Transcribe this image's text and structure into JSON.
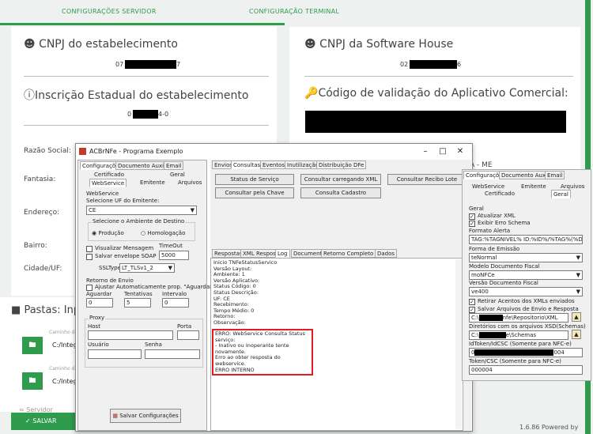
{
  "tabs": {
    "server": "CONFIGURAÇÕES SERVIDOR",
    "terminal": "CONFIGURAÇÃO TERMINAL"
  },
  "cnpj_estab": {
    "title": "CNPJ do estabelecimento",
    "value_start": "07",
    "value_end": "7"
  },
  "cnpj_sh": {
    "title": "CNPJ da Software House",
    "value_start": "02",
    "value_end": "6"
  },
  "ie": {
    "title": "Inscrição Estadual do estabelecimento",
    "value_start": "0",
    "value_end": "4-0"
  },
  "codigo": {
    "title": "Código de validação do Aplicativo Comercial:"
  },
  "fields": {
    "razao": "Razão Social:",
    "fantasia": "Fantasia:",
    "endereco": "Endereço:",
    "bairro": "Bairro:",
    "cidade": "Cidade/UF:",
    "razao_value_tail": "LTDA - ME"
  },
  "pastas": {
    "title": "Pastas: Inp",
    "caminho1": "Caminho da",
    "value1": "C:/Integ",
    "caminho2": "Caminho da",
    "value2": "C:/Integ",
    "servidor": "Servidor"
  },
  "salvar": "SALVAR",
  "powered": "1.6.86 Powered by",
  "window": {
    "title": "ACBrNFe - Programa Exemplo",
    "left_tabs": [
      "Configurações",
      "Documento Auxiliar",
      "Email"
    ],
    "left_subtabs_row1": [
      "Certificado",
      "Geral"
    ],
    "left_subtabs_row2": [
      "WebService",
      "Emitente",
      "Arquivos"
    ],
    "ws_group": "WebService",
    "uf_label": "Selecione UF do Emitente:",
    "uf_value": "CE",
    "amb_group": "Selecione o Ambiente de Destino",
    "amb_producao": "Produção",
    "amb_homolog": "Homologação",
    "visualizar": "Visualizar Mensagem",
    "salvar_soap": "Salvar envelope SOAP",
    "timeout_label": "TimeOut",
    "timeout_value": "5000",
    "ssl_label": "SSLType",
    "ssl_value": "LT_TLSv1_2",
    "retorno_group": "Retorno de Envio",
    "ajustar": "Ajustar Automaticamente prop. \"Aguardar\"",
    "aguardar_l": "Aguardar",
    "tentativas_l": "Tentativas",
    "intervalo_l": "Intervalo",
    "aguardar_v": "0",
    "tentativas_v": "5",
    "intervalo_v": "0",
    "proxy_group": "Proxy",
    "host": "Host",
    "porta": "Porta",
    "usuario": "Usuário",
    "senha": "Senha",
    "salvar_config": "Salvar Configurações",
    "right_tabs": [
      "Envios",
      "Consultas",
      "Eventos",
      "Inutilização",
      "Distribuição DFe"
    ],
    "btn_status": "Status de Serviço",
    "btn_consultar_xml": "Consultar carregando XML",
    "btn_recibo": "Consultar Recibo Lote",
    "btn_chave": "Consultar pela Chave",
    "btn_cadastro": "Consulta Cadastro",
    "resp_tabs": [
      "Respostas",
      "XML Resposta",
      "Log",
      "Documento",
      "Retorno Completo WS",
      "Dados"
    ],
    "log_lines": [
      "Inicio TNFeStatusServico",
      "Versão Layout:",
      "Ambiente: 1",
      "Versão Aplicativo:",
      "Status Código: 0",
      "Status Descrição:",
      "UF: CE",
      "Recebimento:",
      "Tempo Médio: 0",
      "Retorno:",
      "Observação:"
    ],
    "err_lines": [
      "ERRO: WebService Consulta Status serviço:",
      "- Inativo ou Inoperante tente novamente.",
      "Erro ao obter resposta do webservice.",
      "ERRO INTERNO"
    ]
  },
  "side": {
    "tabs": [
      "Configurações",
      "Documento Auxiliar",
      "Email"
    ],
    "sub1": [
      "WebService",
      "Emitente",
      "Arquivos"
    ],
    "sub2": [
      "Certificado",
      "Geral"
    ],
    "geral": "Geral",
    "atualizar": "Atualizar XML",
    "exibir": "Exibir Erro Schema",
    "formato_l": "Formato Alerta",
    "formato_v": "TAG:%TAGNIVEL% ID:%ID%/%TAG%(%DESCRI",
    "forma_l": "Forma de Emissão",
    "forma_v": "teNormal",
    "modelo_l": "Modelo Documento Fiscal",
    "modelo_v": "moNFCe",
    "versao_l": "Versão Documento Fiscal",
    "versao_v": "ve400",
    "retirar": "Retirar Acentos dos XMLs enviados",
    "salvar_arq": "Salvar Arquivos de Envio e Resposta",
    "path1_start": "C:\\",
    "path1_end": "nfe\\Repositorio\\XML",
    "dir_l": "Diretórios com os arquivos XSD(Schemas)",
    "path2_start": "C:\\",
    "path2_end": "e\\Schemas",
    "idtoken_l": "IdToken/IdCSC (Somente para NFC-e)",
    "idtoken_start": "0",
    "idtoken_end": "004",
    "token_l": "Token/CSC (Somente para NFC-e)",
    "token_v": "000004"
  }
}
